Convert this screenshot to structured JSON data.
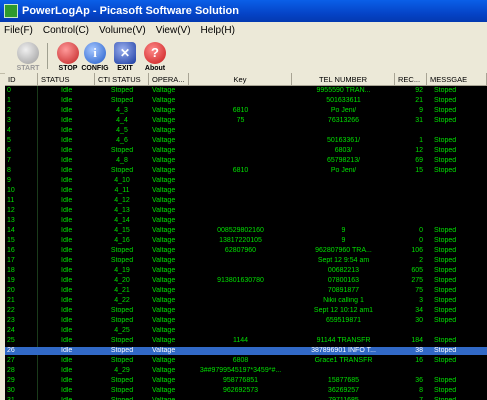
{
  "window": {
    "title": "PowerLogAp - Picasoft Software Solution"
  },
  "menu": [
    "File(F)",
    "Control(C)",
    "Volume(V)",
    "View(V)",
    "Help(H)"
  ],
  "toolbar": [
    {
      "label": "START",
      "icon": "start-icon",
      "color": "#b0b0b0",
      "enabled": false
    },
    {
      "label": "STOP",
      "icon": "stop-icon",
      "color": "#c83030"
    },
    {
      "label": "CONFIG",
      "icon": "info-icon",
      "color": "#2a6ad8"
    },
    {
      "label": "EXIT",
      "icon": "exit-icon",
      "color": "#2a4ab0"
    },
    {
      "label": "About",
      "icon": "help-icon",
      "color": "#d02020"
    }
  ],
  "columns": [
    "ID",
    "STATUS",
    "CTI STATUS",
    "OPERA...",
    "Key",
    "TEL NUMBER",
    "REC...",
    "MESSGAE"
  ],
  "rows": [
    [
      "0",
      "Idle",
      "Stoped",
      "Valtage",
      "",
      "9955590          TRAN...",
      "92",
      "Stoped"
    ],
    [
      "1",
      "Idle",
      "Stoped",
      "Valtage",
      "",
      "501633611",
      "21",
      "Stoped"
    ],
    [
      "2",
      "Idle",
      "4_3",
      "Valtage",
      "6810",
      "Po Jeni/",
      "9",
      "Stoped"
    ],
    [
      "3",
      "Idle",
      "4_4",
      "Valtage",
      "75",
      "76313266",
      "31",
      "Stoped"
    ],
    [
      "4",
      "Idle",
      "4_5",
      "Valtage",
      "",
      "",
      "",
      ""
    ],
    [
      "5",
      "Idle",
      "4_6",
      "Valtage",
      "",
      "50163361/",
      "1",
      "Stoped"
    ],
    [
      "6",
      "Idle",
      "Stoped",
      "Valtage",
      "",
      "6803/",
      "12",
      "Stoped"
    ],
    [
      "7",
      "Idle",
      "4_8",
      "Valtage",
      "",
      "65798213/",
      "69",
      "Stoped"
    ],
    [
      "8",
      "Idle",
      "Stoped",
      "Valtage",
      "6810",
      "Po Jeni/",
      "15",
      "Stoped"
    ],
    [
      "9",
      "Idle",
      "4_10",
      "Valtage",
      "",
      "",
      "",
      ""
    ],
    [
      "10",
      "Idle",
      "4_11",
      "Valtage",
      "",
      "",
      "",
      ""
    ],
    [
      "11",
      "Idle",
      "4_12",
      "Valtage",
      "",
      "",
      "",
      ""
    ],
    [
      "12",
      "Idle",
      "4_13",
      "Valtage",
      "",
      "",
      "",
      ""
    ],
    [
      "13",
      "Idle",
      "4_14",
      "Valtage",
      "",
      "",
      "",
      ""
    ],
    [
      "14",
      "Idle",
      "4_15",
      "Valtage",
      "008529802160",
      "9",
      "0",
      "Stoped"
    ],
    [
      "15",
      "Idle",
      "4_16",
      "Valtage",
      "13817220105",
      "9",
      "0",
      "Stoped"
    ],
    [
      "16",
      "Idle",
      "Stoped",
      "Valtage",
      "62807960",
      "962807960          TRA...",
      "106",
      "Stoped"
    ],
    [
      "17",
      "Idle",
      "Stoped",
      "Valtage",
      "",
      "Sept 12 9:54 am",
      "2",
      "Stoped"
    ],
    [
      "18",
      "Idle",
      "4_19",
      "Valtage",
      "",
      "00682213",
      "605",
      "Stoped"
    ],
    [
      "19",
      "Idle",
      "4_20",
      "Valtage",
      "913801630780",
      "07800163",
      "275",
      "Stoped"
    ],
    [
      "20",
      "Idle",
      "4_21",
      "Valtage",
      "",
      "70891877",
      "75",
      "Stoped"
    ],
    [
      "21",
      "Idle",
      "4_22",
      "Valtage",
      "",
      "Nikii calling 1",
      "3",
      "Stoped"
    ],
    [
      "22",
      "Idle",
      "Stoped",
      "Valtage",
      "",
      "Sept 12 10:12 am1",
      "34",
      "Stoped"
    ],
    [
      "23",
      "Idle",
      "Stoped",
      "Valtage",
      "",
      "659519871",
      "30",
      "Stoped"
    ],
    [
      "24",
      "Idle",
      "4_25",
      "Valtage",
      "",
      "",
      "",
      ""
    ],
    [
      "25",
      "Idle",
      "Stoped",
      "Valtage",
      "1144",
      "91144          TRANSFR",
      "184",
      "Stoped"
    ],
    [
      "26",
      "Idle",
      "Stoped",
      "Valtage",
      "",
      "387896901      INFO     T...",
      "38",
      "Stoped"
    ],
    [
      "27",
      "Idle",
      "Stoped",
      "Valtage",
      "6808",
      "Grace1          TRANSFR",
      "16",
      "Stoped"
    ],
    [
      "28",
      "Idle",
      "4_29",
      "Valtage",
      "3##9799545197*3459*#...",
      "",
      "",
      ""
    ],
    [
      "29",
      "Idle",
      "Stoped",
      "Valtage",
      "958776851",
      "15877685",
      "36",
      "Stoped"
    ],
    [
      "30",
      "Idle",
      "Stoped",
      "Valtage",
      "962692573",
      "36269257",
      "8",
      "Stoped"
    ],
    [
      "31",
      "Idle",
      "Stoped",
      "Valtage",
      "",
      "79711685",
      "7",
      "Stoped"
    ]
  ],
  "selected_row": "26",
  "colors": {
    "grid_bg": "#000000",
    "text": "#00e000",
    "selection": "#3169c6",
    "titlebar": "#0544c8"
  }
}
